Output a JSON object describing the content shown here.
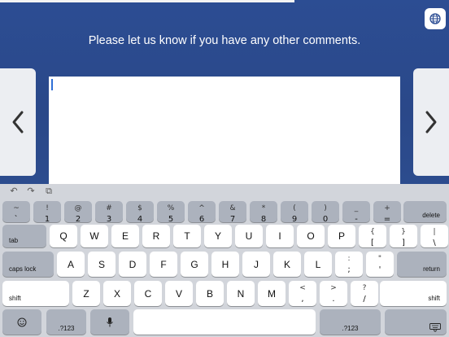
{
  "prompt": "Please let us know if you have any other comments.",
  "comment_value": "",
  "toolbar": {
    "undo": "↶",
    "redo": "↷",
    "paste": "⧉"
  },
  "rows": {
    "numbers": [
      {
        "top": "~",
        "bottom": "`"
      },
      {
        "top": "!",
        "bottom": "1"
      },
      {
        "top": "@",
        "bottom": "2"
      },
      {
        "top": "#",
        "bottom": "3"
      },
      {
        "top": "$",
        "bottom": "4"
      },
      {
        "top": "%",
        "bottom": "5"
      },
      {
        "top": "^",
        "bottom": "6"
      },
      {
        "top": "&",
        "bottom": "7"
      },
      {
        "top": "*",
        "bottom": "8"
      },
      {
        "top": "(",
        "bottom": "9"
      },
      {
        "top": ")",
        "bottom": "0"
      },
      {
        "top": "_",
        "bottom": "-"
      },
      {
        "top": "+",
        "bottom": "="
      }
    ],
    "qwerty": [
      "Q",
      "W",
      "E",
      "R",
      "T",
      "Y",
      "U",
      "I",
      "O",
      "P"
    ],
    "qwerty_symbols": [
      {
        "top": "{",
        "bottom": "["
      },
      {
        "top": "}",
        "bottom": "]"
      },
      {
        "top": "|",
        "bottom": "\\"
      }
    ],
    "asdf": [
      "A",
      "S",
      "D",
      "F",
      "G",
      "H",
      "J",
      "K",
      "L"
    ],
    "asdf_symbols": [
      {
        "top": ":",
        "bottom": ";"
      },
      {
        "top": "\"",
        "bottom": "'"
      }
    ],
    "zxcv": [
      "Z",
      "X",
      "C",
      "V",
      "B",
      "N",
      "M"
    ],
    "zxcv_symbols": [
      {
        "top": "<",
        "bottom": ","
      },
      {
        "top": ">",
        "bottom": "."
      },
      {
        "top": "?",
        "bottom": "/"
      }
    ]
  },
  "keys": {
    "delete": "delete",
    "tab": "tab",
    "caps_lock": "caps lock",
    "return": "return",
    "shift_left": "shift",
    "shift_right": "shift",
    "numbers_left": ".?123",
    "numbers_right": ".?123"
  }
}
